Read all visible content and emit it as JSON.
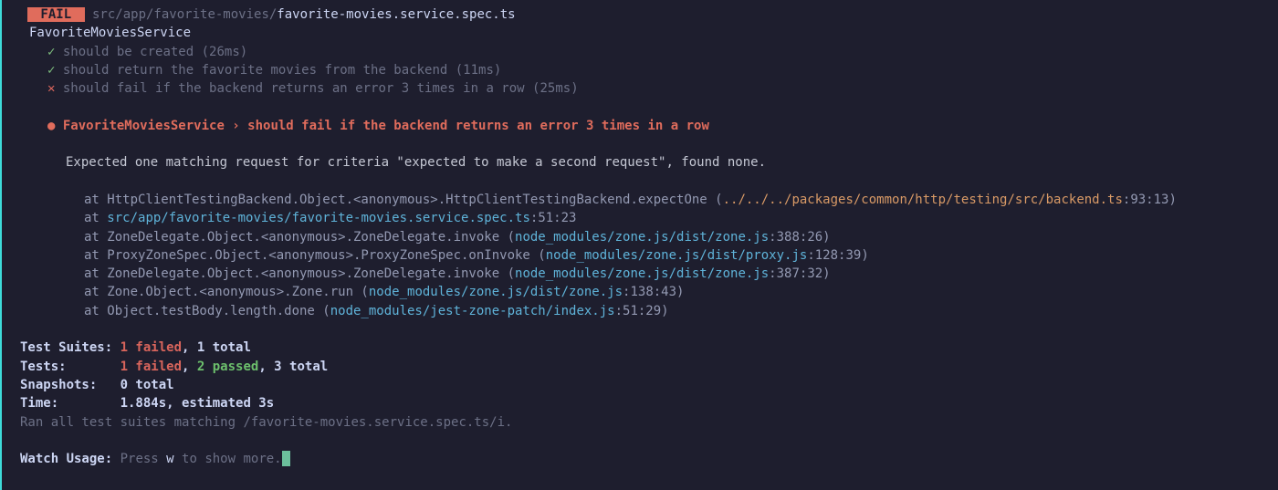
{
  "header": {
    "fail_badge": " FAIL ",
    "path_dim": " src/app/favorite-movies/",
    "path_bright": "favorite-movies.service.spec.ts"
  },
  "suite": "FavoriteMoviesService",
  "tests": [
    {
      "mark": "✓",
      "name": "should be created",
      "time": "(26ms)"
    },
    {
      "mark": "✓",
      "name": "should return the favorite movies from the backend",
      "time": "(11ms)"
    },
    {
      "mark": "✕",
      "name": "should fail if the backend returns an error 3 times in a row",
      "time": "(25ms)"
    }
  ],
  "failure": {
    "bullet": "●",
    "title": " FavoriteMoviesService › should fail if the backend returns an error 3 times in a row",
    "message": "Expected one matching request for criteria \"expected to make a second request\", found none."
  },
  "stack": [
    {
      "pre": "at HttpClientTestingBackend.Object.<anonymous>.HttpClientTestingBackend.expectOne (",
      "link": "../../../packages/common/http/testing/src/backend.ts",
      "loc": ":93:13)",
      "link_class": "link-orange"
    },
    {
      "pre": "at ",
      "link": "src/app/favorite-movies/favorite-movies.service.spec.ts",
      "loc": ":51:23",
      "link_class": "link"
    },
    {
      "pre": "at ZoneDelegate.Object.<anonymous>.ZoneDelegate.invoke (",
      "link": "node_modules/zone.js/dist/zone.js",
      "loc": ":388:26)",
      "link_class": "link"
    },
    {
      "pre": "at ProxyZoneSpec.Object.<anonymous>.ProxyZoneSpec.onInvoke (",
      "link": "node_modules/zone.js/dist/proxy.js",
      "loc": ":128:39)",
      "link_class": "link"
    },
    {
      "pre": "at ZoneDelegate.Object.<anonymous>.ZoneDelegate.invoke (",
      "link": "node_modules/zone.js/dist/zone.js",
      "loc": ":387:32)",
      "link_class": "link"
    },
    {
      "pre": "at Zone.Object.<anonymous>.Zone.run (",
      "link": "node_modules/zone.js/dist/zone.js",
      "loc": ":138:43)",
      "link_class": "link"
    },
    {
      "pre": "at Object.testBody.length.done (",
      "link": "node_modules/jest-zone-patch/index.js",
      "loc": ":51:29)",
      "link_class": "link"
    }
  ],
  "summary": {
    "test_suites_label": "Test Suites: ",
    "test_suites_fail": "1 failed",
    "test_suites_total": ", 1 total",
    "tests_label": "Tests:       ",
    "tests_fail": "1 failed",
    "tests_sep": ", ",
    "tests_pass": "2 passed",
    "tests_total": ", 3 total",
    "snapshots_label": "Snapshots:   ",
    "snapshots_val": "0 total",
    "time_label": "Time:        ",
    "time_val": "1.884s, estimated 3s",
    "ran_prefix": "Ran all test suites matching ",
    "ran_pattern": "/favorite-movies.service.spec.ts/i",
    "ran_suffix": "."
  },
  "watch": {
    "label": "Watch Usage:",
    "prefix": " Press ",
    "key": "w",
    "suffix": " to show more."
  }
}
